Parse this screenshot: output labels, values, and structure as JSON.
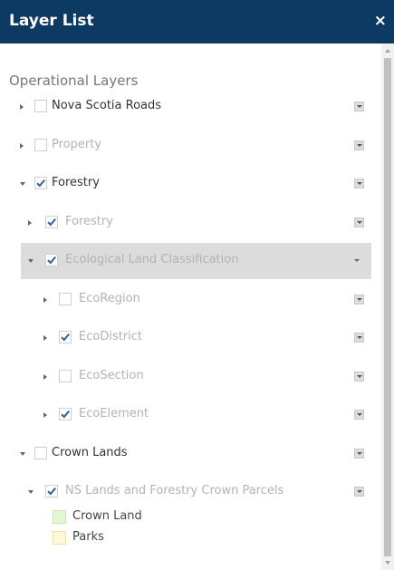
{
  "header": {
    "title": "Layer List",
    "close_glyph": "×"
  },
  "section_title": "Operational Layers",
  "layers": [
    {
      "label": "Nova Scotia Roads",
      "checked": false,
      "expanded": false,
      "dim": false,
      "level": 0
    },
    {
      "label": "Property",
      "checked": false,
      "expanded": false,
      "dim": true,
      "level": 0
    },
    {
      "label": "Forestry",
      "checked": true,
      "expanded": true,
      "dim": false,
      "level": 0
    },
    {
      "label": "Forestry",
      "checked": true,
      "expanded": false,
      "dim": true,
      "level": 1
    },
    {
      "label": "Ecological Land Classification",
      "checked": true,
      "expanded": true,
      "dim": true,
      "level": 1,
      "selected": true
    },
    {
      "label": "EcoRegion",
      "checked": false,
      "expanded": false,
      "dim": true,
      "level": 2
    },
    {
      "label": "EcoDistrict",
      "checked": true,
      "expanded": false,
      "dim": true,
      "level": 2
    },
    {
      "label": "EcoSection",
      "checked": false,
      "expanded": false,
      "dim": true,
      "level": 2
    },
    {
      "label": "EcoElement",
      "checked": true,
      "expanded": false,
      "dim": true,
      "level": 2
    },
    {
      "label": "Crown Lands",
      "checked": false,
      "expanded": true,
      "dim": false,
      "level": 0
    },
    {
      "label": "NS Lands and Forestry Crown Parcels",
      "checked": true,
      "expanded": true,
      "dim": true,
      "level": 1
    }
  ],
  "legend": [
    {
      "label": "Crown Land",
      "fill": "#e5f6d6",
      "stroke": "#c9e4b6"
    },
    {
      "label": "Parks",
      "fill": "#fdf8d8",
      "stroke": "#ece3b0"
    }
  ],
  "colors": {
    "header_bg": "#0d3a63",
    "selected_row": "#dcdcdc",
    "check": "#2f5f9b"
  }
}
